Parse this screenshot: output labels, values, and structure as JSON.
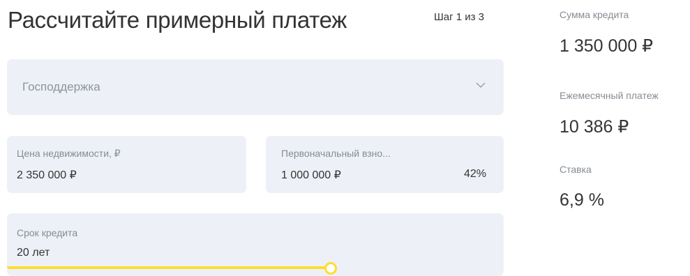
{
  "calculator": {
    "title": "Рассчитайте примерный платеж",
    "step": "Шаг 1 из 3",
    "program": {
      "placeholder": "Господдержка",
      "icon": "chevron-down-icon"
    },
    "property_price": {
      "label": "Цена недвижимости, ₽",
      "value": "2 350 000 ₽"
    },
    "down_payment": {
      "label": "Первоначальный взно...",
      "value": "1 000 000 ₽",
      "percent": "42%"
    },
    "loan_term": {
      "label": "Срок кредита",
      "value": "20 лет",
      "slider_level": 0.65
    }
  },
  "summary": {
    "loan_amount": {
      "label": "Сумма кредита",
      "value": "1 350 000 ₽"
    },
    "monthly_payment": {
      "label": "Ежемесячный платеж",
      "value": "10 386 ₽"
    },
    "rate": {
      "label": "Ставка",
      "value": "6,9 %"
    }
  },
  "colors": {
    "accent": "#ffdd2d",
    "field_background": "#edf1f7",
    "text": "#333333",
    "muted_text": "#858c94"
  }
}
